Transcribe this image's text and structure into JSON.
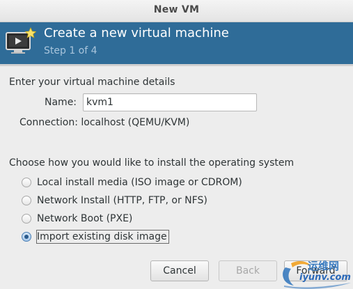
{
  "window": {
    "title": "New VM"
  },
  "banner": {
    "title": "Create a new virtual machine",
    "step": "Step 1 of 4",
    "icon": "vm-monitor-icon"
  },
  "details": {
    "heading": "Enter your virtual machine details",
    "name_label": "Name:",
    "name_value": "kvm1",
    "connection_label": "Connection:",
    "connection_value": "localhost (QEMU/KVM)"
  },
  "install": {
    "heading": "Choose how you would like to install the operating system",
    "options": [
      {
        "label": "Local install media (ISO image or CDROM)",
        "checked": false
      },
      {
        "label": "Network Install (HTTP, FTP, or NFS)",
        "checked": false
      },
      {
        "label": "Network Boot (PXE)",
        "checked": false
      },
      {
        "label": "Import existing disk image",
        "checked": true
      }
    ]
  },
  "buttons": {
    "cancel": "Cancel",
    "back": "Back",
    "forward": "Forward"
  },
  "watermark": {
    "line1": "运维网",
    "line2": "iyunv.com"
  },
  "colors": {
    "banner": "#2f6c98",
    "watermark": "#3a7bbf"
  }
}
